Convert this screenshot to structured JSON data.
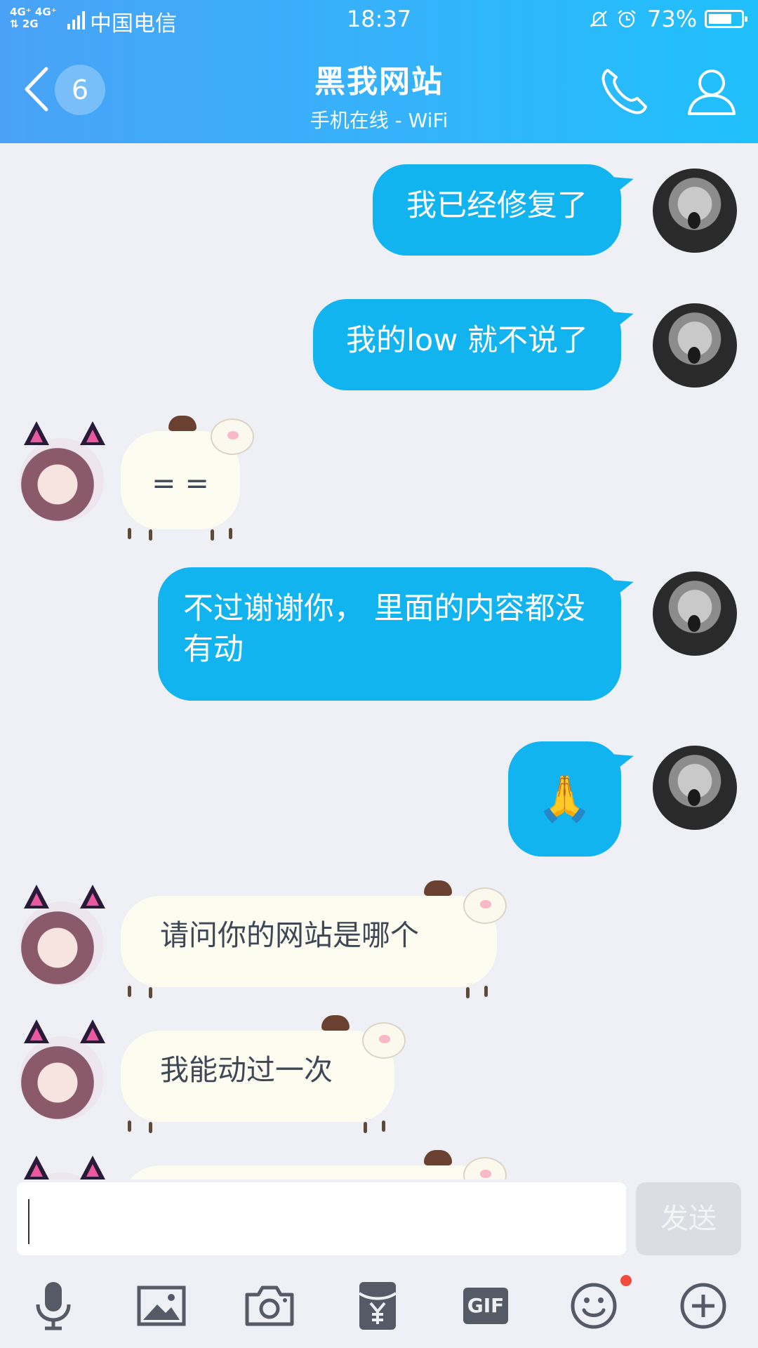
{
  "status_bar": {
    "network_top": "4G⁺ 4G⁺",
    "network_bottom": "⇅ 2G",
    "carrier": "中国电信",
    "time": "18:37",
    "battery_pct": "73%",
    "battery_level": 0.73
  },
  "header": {
    "unread_count": "6",
    "title": "黑我网站",
    "subtitle": "手机在线 - WiFi"
  },
  "messages": [
    {
      "side": "out",
      "text": "我已经修复了"
    },
    {
      "side": "out",
      "text": "我的low 就不说了"
    },
    {
      "side": "in",
      "text": "= ="
    },
    {
      "side": "out",
      "text": "不过谢谢你， 里面的内容都没有动"
    },
    {
      "side": "out",
      "text": "🙏"
    },
    {
      "side": "in",
      "text": "请问你的网站是哪个"
    },
    {
      "side": "in",
      "text": "我能动过一次"
    }
  ],
  "composer": {
    "input_value": "",
    "send_label": "发送",
    "gif_label": "GIF"
  },
  "toolbar_icons": [
    "microphone-icon",
    "image-icon",
    "camera-icon",
    "red-packet-icon",
    "gif-icon",
    "emoji-icon",
    "plus-icon"
  ],
  "colors": {
    "header_gradient_start": "#4aa2f6",
    "header_gradient_end": "#1fc0fb",
    "outgoing_bubble": "#12b4f0",
    "incoming_bubble": "#fdfcf0",
    "background": "#eff0f6",
    "notification_dot": "#f24a3c"
  }
}
